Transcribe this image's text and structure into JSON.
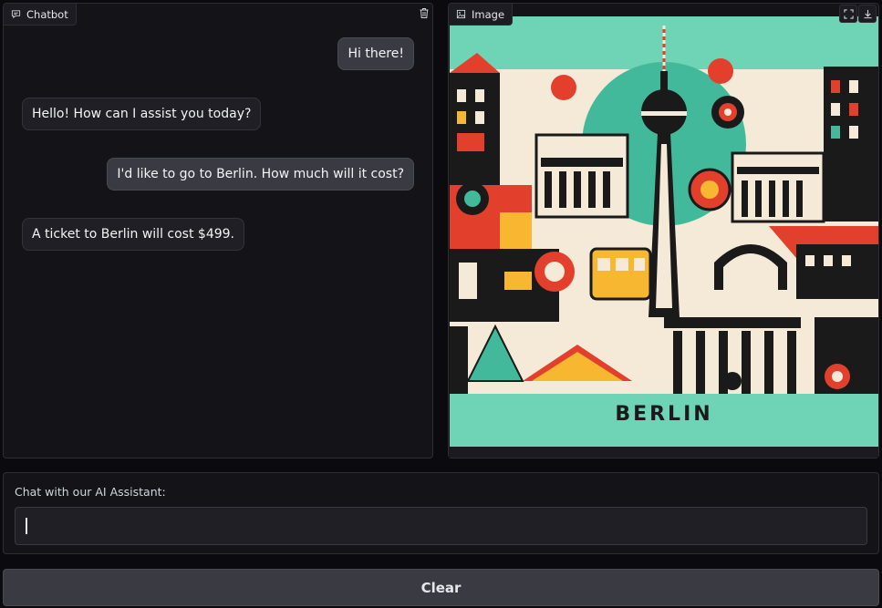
{
  "chatbot": {
    "label": "Chatbot",
    "messages": [
      {
        "role": "user",
        "text": "Hi there!"
      },
      {
        "role": "bot",
        "text": "Hello! How can I assist you today?"
      },
      {
        "role": "user",
        "text": "I'd like to go to Berlin. How much will it cost?"
      },
      {
        "role": "bot",
        "text": "A ticket to Berlin will cost $499."
      }
    ]
  },
  "image_panel": {
    "label": "Image",
    "poster_title": "BERLIN"
  },
  "input": {
    "label": "Chat with our AI Assistant:",
    "value": "",
    "placeholder": ""
  },
  "actions": {
    "clear_label": "Clear"
  },
  "icons": {
    "chatbot": "chat-icon",
    "delete": "trash-icon",
    "image": "image-icon",
    "fullscreen": "fullscreen-icon",
    "download": "download-icon"
  },
  "colors": {
    "background": "#0b0b0f",
    "panel": "#141418",
    "user_bubble": "#3a3a42",
    "bot_bubble": "#1f1f25",
    "poster_bg": "#6fd3b6"
  }
}
